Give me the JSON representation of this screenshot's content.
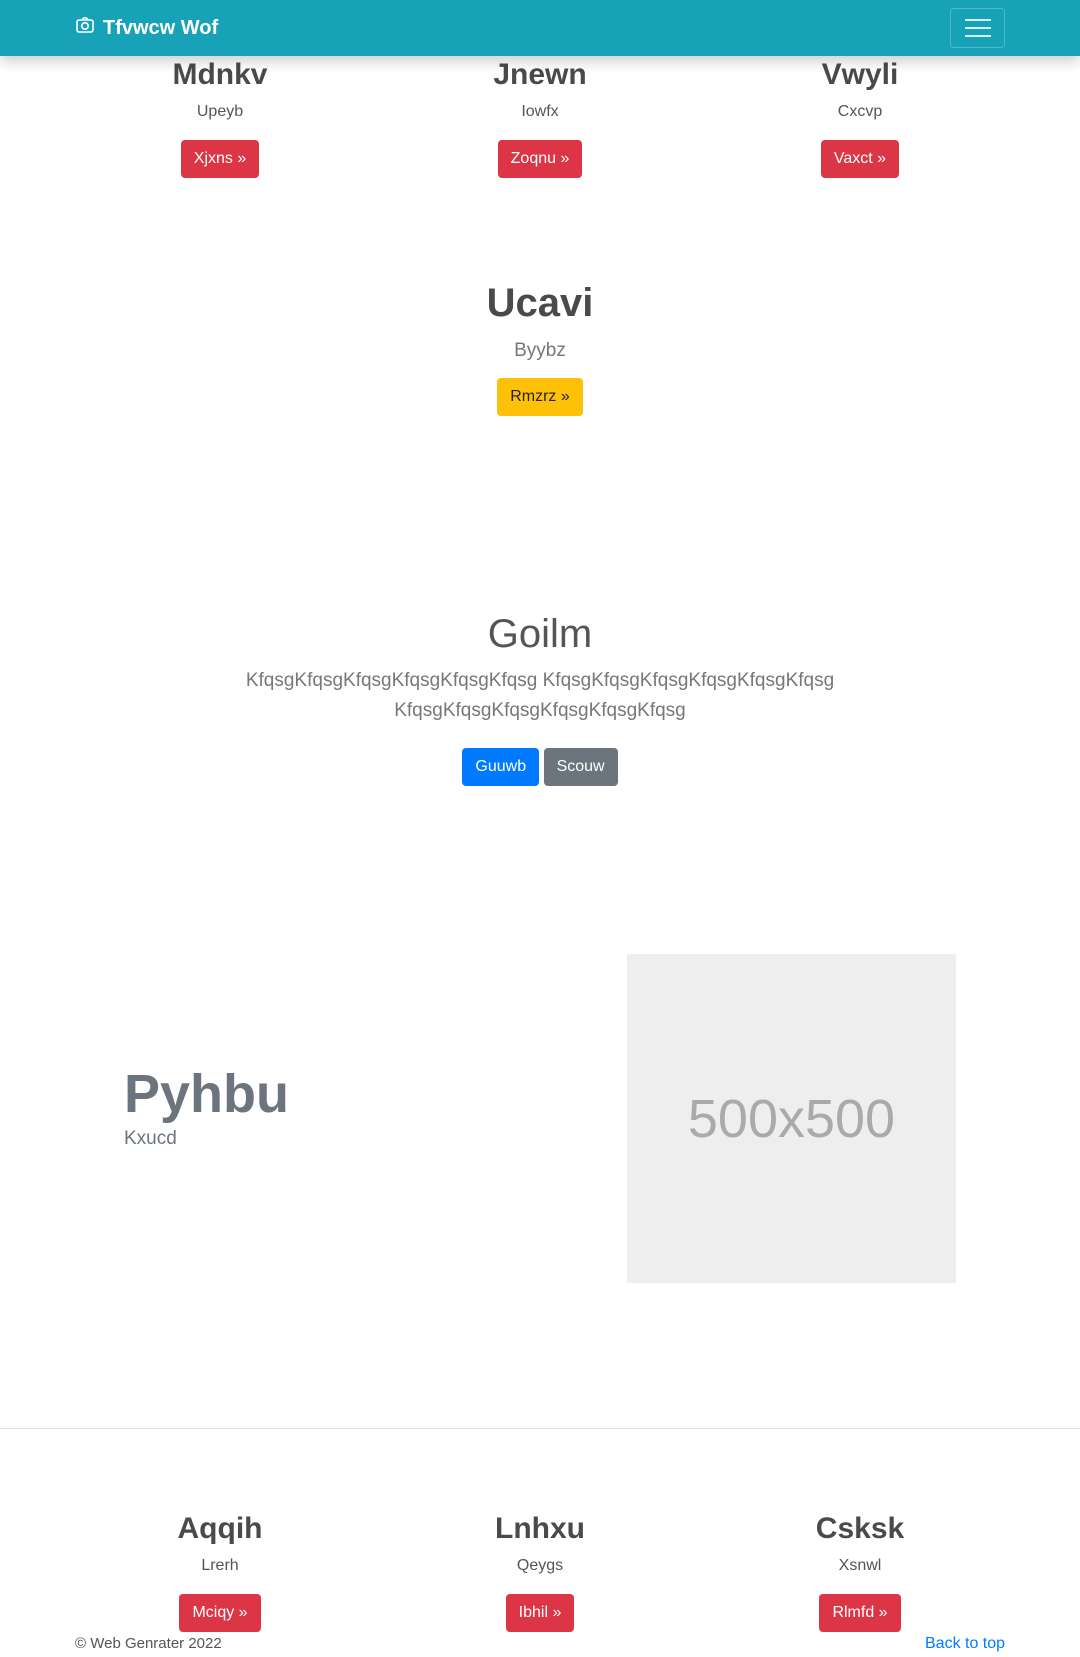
{
  "navbar": {
    "brand": "Tfvwcw Wof",
    "brand_icon": "camera-icon",
    "color": "#17a2b8"
  },
  "top_columns": [
    {
      "title": "Mdnkv",
      "subtitle": "Upeyb",
      "button": "Xjxns »"
    },
    {
      "title": "Jnewn",
      "subtitle": "Iowfx",
      "button": "Zoqnu »"
    },
    {
      "title": "Vwyli",
      "subtitle": "Cxcvp",
      "button": "Vaxct »"
    }
  ],
  "single_feature": {
    "title": "Ucavi",
    "subtitle": "Byybz",
    "button": "Rmzrz »"
  },
  "hero": {
    "title": "Goilm",
    "text": "KfqsgKfqsgKfqsgKfqsgKfqsgKfqsg KfqsgKfqsgKfqsgKfqsgKfqsgKfqsg KfqsgKfqsgKfqsgKfqsgKfqsgKfqsg",
    "primary_button": "Guuwb",
    "secondary_button": "Scouw"
  },
  "feature": {
    "title": "Pyhbu",
    "subtitle": "Kxucd",
    "image_label": "500x500"
  },
  "bottom_columns": [
    {
      "title": "Aqqih",
      "subtitle": "Lrerh",
      "button": "Mciqy »"
    },
    {
      "title": "Lnhxu",
      "subtitle": "Qeygs",
      "button": "Ibhil »"
    },
    {
      "title": "Csksk",
      "subtitle": "Xsnwl",
      "button": "Rlmfd »"
    }
  ],
  "footer": {
    "copyright": "© Web Genrater 2022",
    "back_to_top": "Back to top"
  },
  "colors": {
    "danger": "#dc3545",
    "warning": "#ffc107",
    "primary": "#007bff",
    "secondary": "#6c757d"
  }
}
